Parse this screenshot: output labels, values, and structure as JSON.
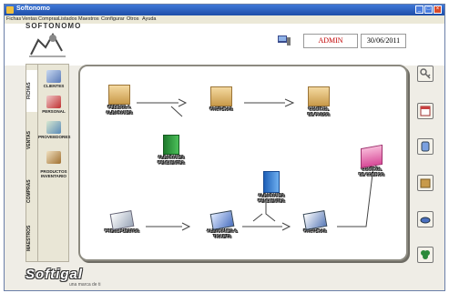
{
  "window": {
    "title": "Softonomo"
  },
  "menu": [
    "Fichas",
    "Ventas",
    "Compras",
    "Listados",
    "Maestros",
    "Configurar",
    "Otros",
    "Ayuda"
  ],
  "header": {
    "logo_text": "SOFTONOMO",
    "user": "ADMIN",
    "date": "30/06/2011"
  },
  "sidebar": {
    "tabs": [
      "FICHAS",
      "VENTAS",
      "COMPRAS",
      "MAESTROS"
    ],
    "items": [
      {
        "label": "CLIENTES"
      },
      {
        "label": "PERSONAL"
      },
      {
        "label": "PROVEEDORES"
      },
      {
        "label": "PRODUCTOS\nINVENTARIO"
      }
    ]
  },
  "diagram": {
    "nodes": [
      {
        "id": "pedidos",
        "label": "PEDIDOS A\nALBARANES",
        "icon": "box-icon"
      },
      {
        "id": "facturas_top",
        "label": "FACTURAS",
        "icon": "box-icon"
      },
      {
        "id": "control_pagos",
        "label": "CONTROL\nDE PAGOS",
        "icon": "box-icon"
      },
      {
        "id": "alb_pend_green",
        "label": "ALBARANES\nPENDIENTES",
        "icon": "green-book-icon"
      },
      {
        "id": "alb_pend_blue",
        "label": "ALBARANES\nPENDIENTES",
        "icon": "blue-book-icon"
      },
      {
        "id": "control_cobros",
        "label": "CONTROL\nDE COBROS",
        "icon": "pink-box-icon"
      },
      {
        "id": "presupuestos",
        "label": "PRESUPUESTOS",
        "icon": "papers-icon"
      },
      {
        "id": "albaranes_tickets",
        "label": "ALBARANES &\nTICKETS",
        "icon": "papers-icon"
      },
      {
        "id": "facturas_bottom",
        "label": "FACTURAS",
        "icon": "papers-icon"
      }
    ]
  },
  "footer": {
    "logo": "Softigal",
    "tagline": "una marca de ti"
  },
  "colors": {
    "titlebar": "#2a5fc4",
    "accent_red": "#c00000"
  }
}
